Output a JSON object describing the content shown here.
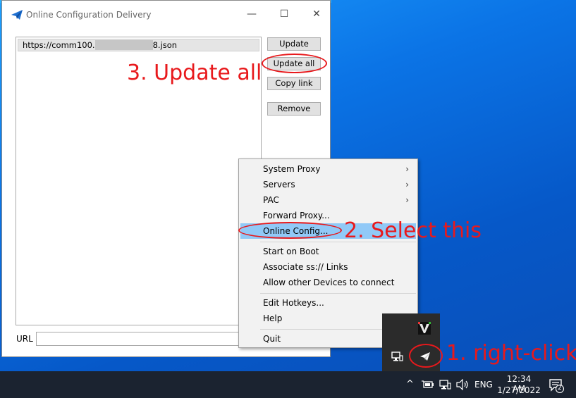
{
  "window": {
    "title": "Online Configuration Delivery",
    "caption_buttons": {
      "minimize": "—",
      "maximize": "☐",
      "close": "✕"
    },
    "server_list": [
      {
        "url_prefix": "https://comm100.",
        "url_suffix": "8.json"
      }
    ],
    "buttons": {
      "update": "Update",
      "update_all": "Update all",
      "copy_link": "Copy link",
      "remove": "Remove"
    },
    "url_label": "URL",
    "url_value": ""
  },
  "context_menu": {
    "items": [
      {
        "label": "System Proxy",
        "submenu": true
      },
      {
        "label": "Servers",
        "submenu": true
      },
      {
        "label": "PAC",
        "submenu": true
      },
      {
        "label": "Forward Proxy...",
        "submenu": false
      },
      {
        "label": "Online Config...",
        "submenu": false,
        "highlighted": true
      },
      {
        "label": "Start on Boot",
        "submenu": false
      },
      {
        "label": "Associate ss:// Links",
        "submenu": false
      },
      {
        "label": "Allow other Devices to connect",
        "submenu": false
      },
      {
        "label": "Edit Hotkeys...",
        "submenu": false
      },
      {
        "label": "Help",
        "submenu": true
      },
      {
        "label": "Quit",
        "submenu": false
      }
    ],
    "submenu_arrow": "›"
  },
  "annotations": {
    "step1": "1. right-click",
    "step2": "2. Select this",
    "step3": "3. Update all",
    "color": "#e8191c"
  },
  "taskbar": {
    "language": "ENG",
    "time": "12:34 AM",
    "date": "1/27/2022",
    "notification_count": "2",
    "chevron": "^"
  },
  "colors": {
    "menu_highlight": "#91c9f7",
    "desktop_blue": "#0b74e6",
    "taskbar": "#1b2330"
  }
}
